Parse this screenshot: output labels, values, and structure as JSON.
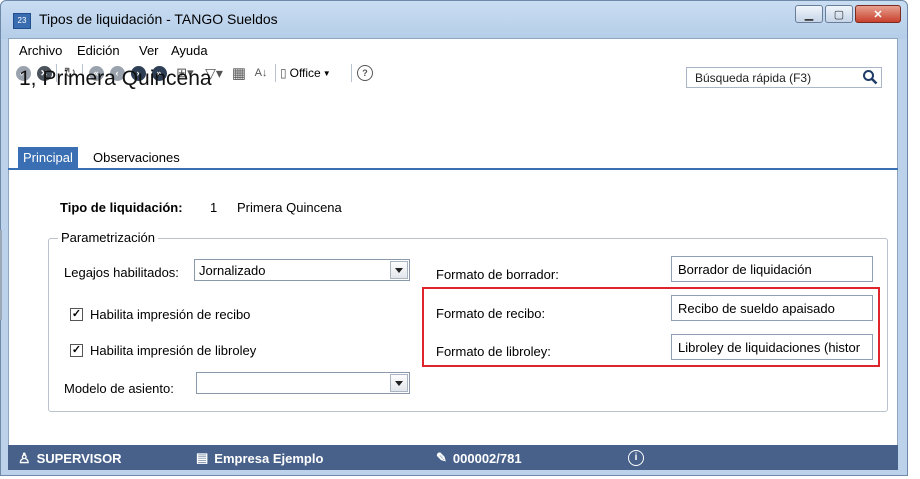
{
  "window": {
    "title": "Tipos de liquidación - TANGO Sueldos"
  },
  "menu": [
    "Archivo",
    "Edición",
    "Ver",
    "Ayuda"
  ],
  "toolbar": {
    "office_label": "Office"
  },
  "record": {
    "title": "1, Primera Quincena"
  },
  "search": {
    "placeholder": "Búsqueda rápida (F3)"
  },
  "tabs": [
    {
      "label": "Principal",
      "active": true
    },
    {
      "label": "Observaciones",
      "active": false
    }
  ],
  "form": {
    "tipo_label": "Tipo de liquidación:",
    "tipo_code": "1",
    "tipo_name": "Primera Quincena",
    "group_legend": "Parametrización",
    "legajos_label": "Legajos habilitados:",
    "legajos_value": "Jornalizado",
    "recibo_check_label": "Habilita impresión de recibo",
    "recibo_checked": true,
    "libroley_check_label": "Habilita impresión de libroley",
    "libroley_checked": true,
    "modelo_label": "Modelo de asiento:",
    "modelo_value": "",
    "borrador_label": "Formato de borrador:",
    "borrador_value": "Borrador de liquidación",
    "recibo_label": "Formato de recibo:",
    "recibo_value": "Recibo de sueldo apaisado",
    "libroley_label": "Formato de libroley:",
    "libroley_value": "Libroley de liquidaciones (histor"
  },
  "status": {
    "user": "SUPERVISOR",
    "company": "Empresa Ejemplo",
    "record": "000002/781"
  },
  "colors": {
    "accent": "#3a6fb3",
    "status_bg": "#48618a",
    "highlight": "#e0242c"
  }
}
